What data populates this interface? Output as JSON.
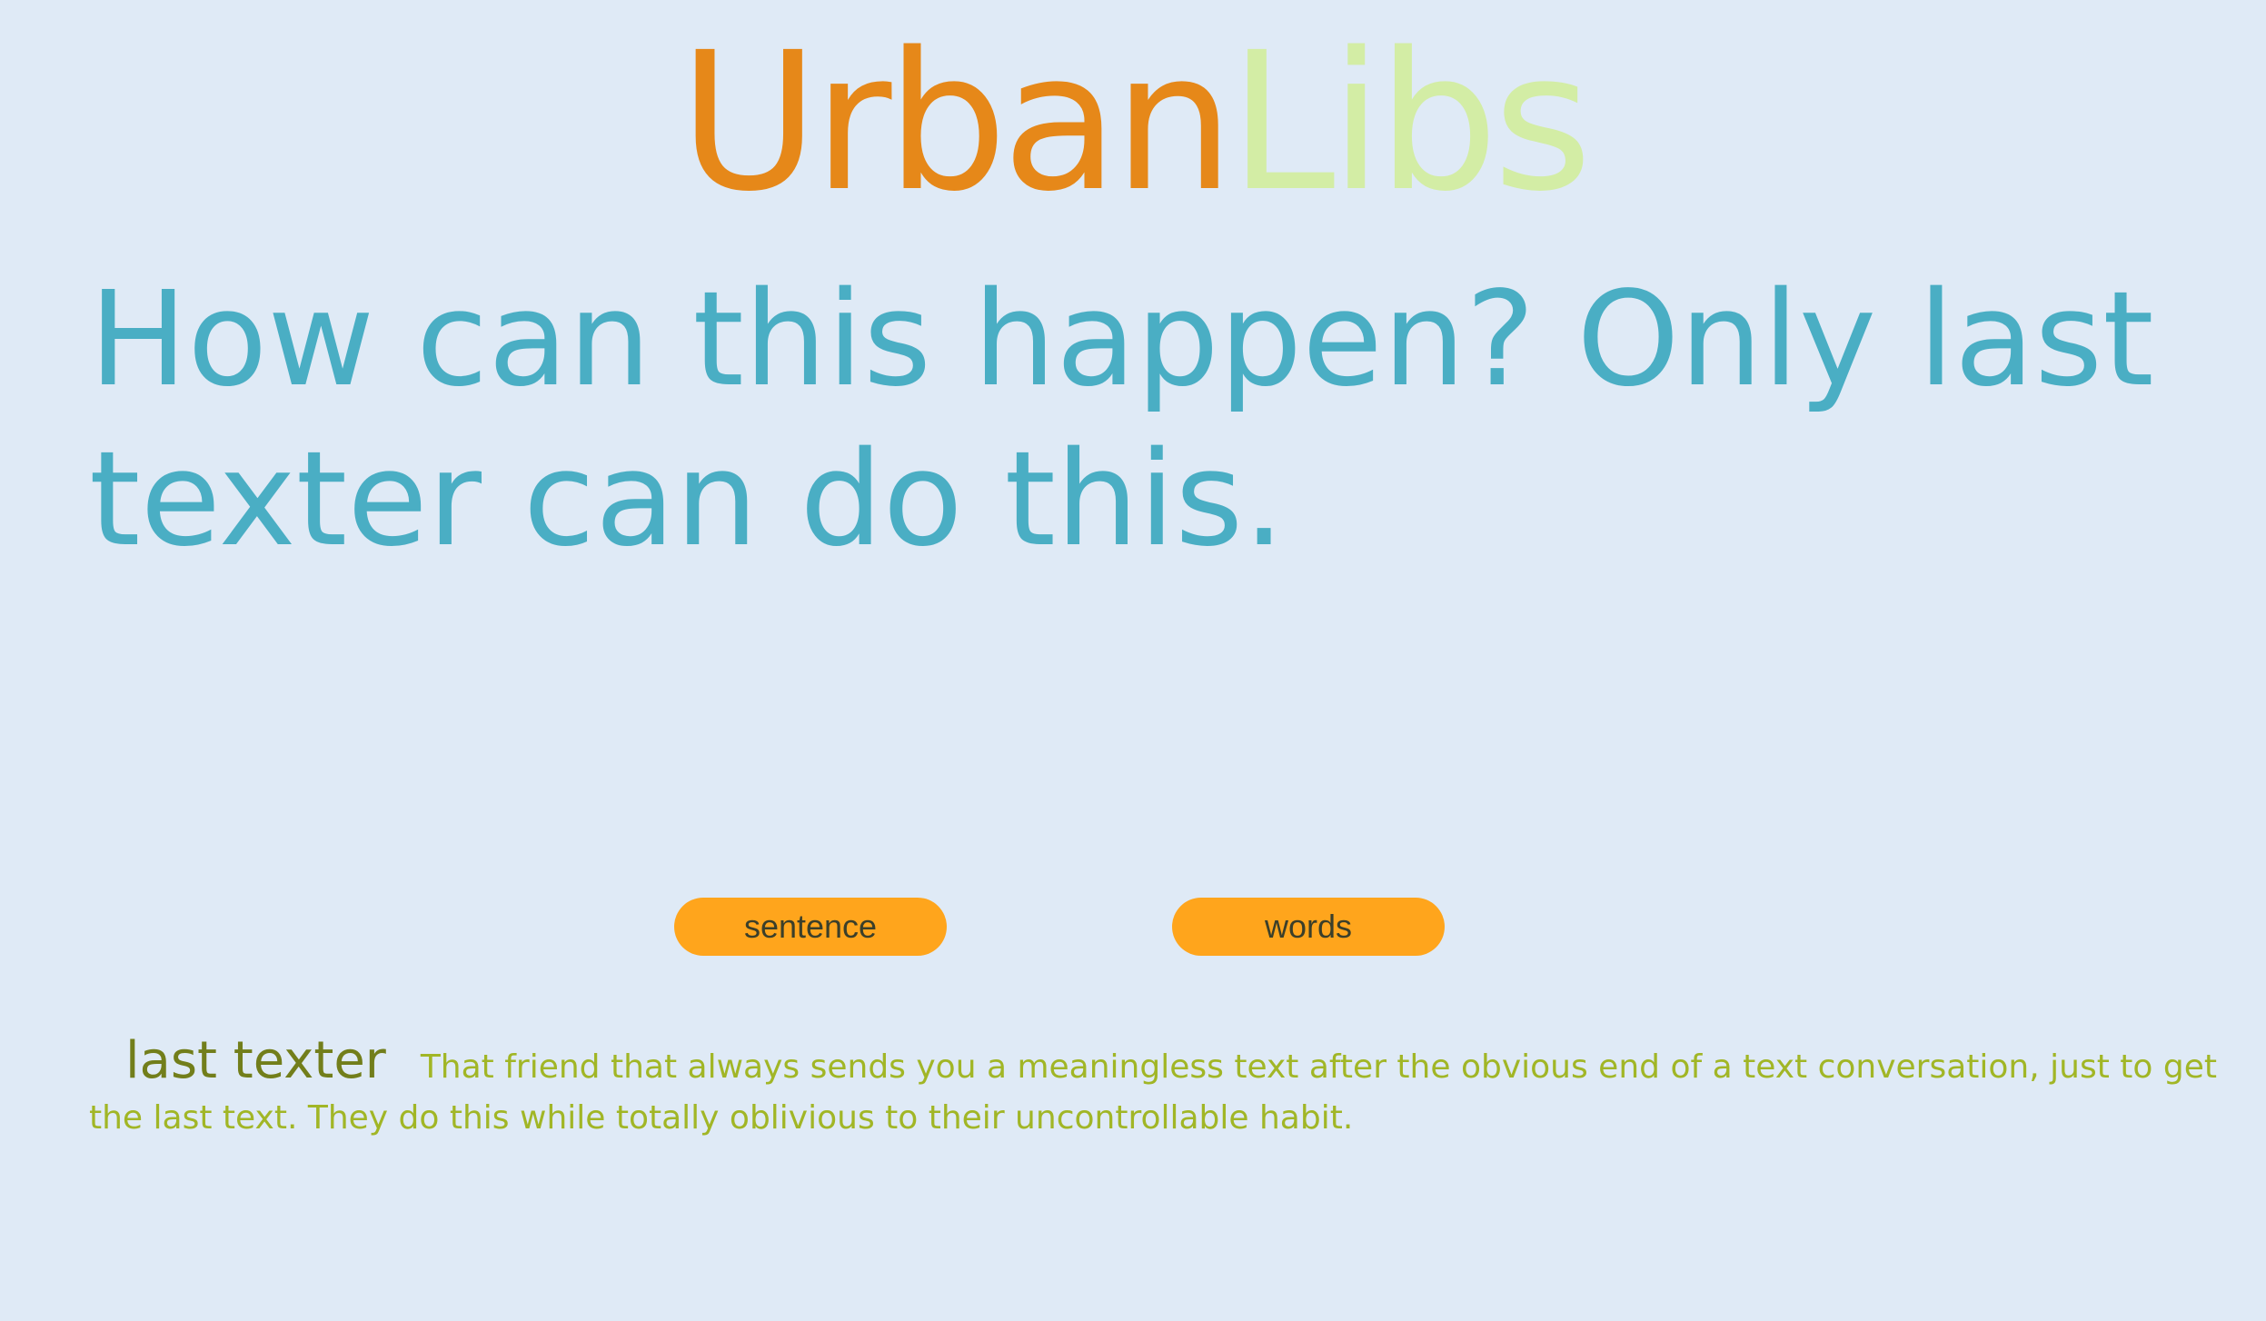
{
  "logo": {
    "part1": "Urban",
    "part2": "Libs",
    "color1": "#e68819",
    "color2": "#d3eda5"
  },
  "main": {
    "sentence": "How can this happen? Only last texter can do this."
  },
  "buttons": {
    "sentence_label": "sentence",
    "words_label": "words",
    "color": "#ffa51c"
  },
  "definition": {
    "term": "last texter",
    "text": "That friend that always sends you a meaningless text after the obvious end of a text conversation, just to get the last text. They do this while totally oblivious to their uncontrollable habit."
  },
  "colors": {
    "background": "#dfeaf6",
    "sentence": "#4aaec4",
    "term": "#727e1b",
    "definition": "#a1b626"
  }
}
